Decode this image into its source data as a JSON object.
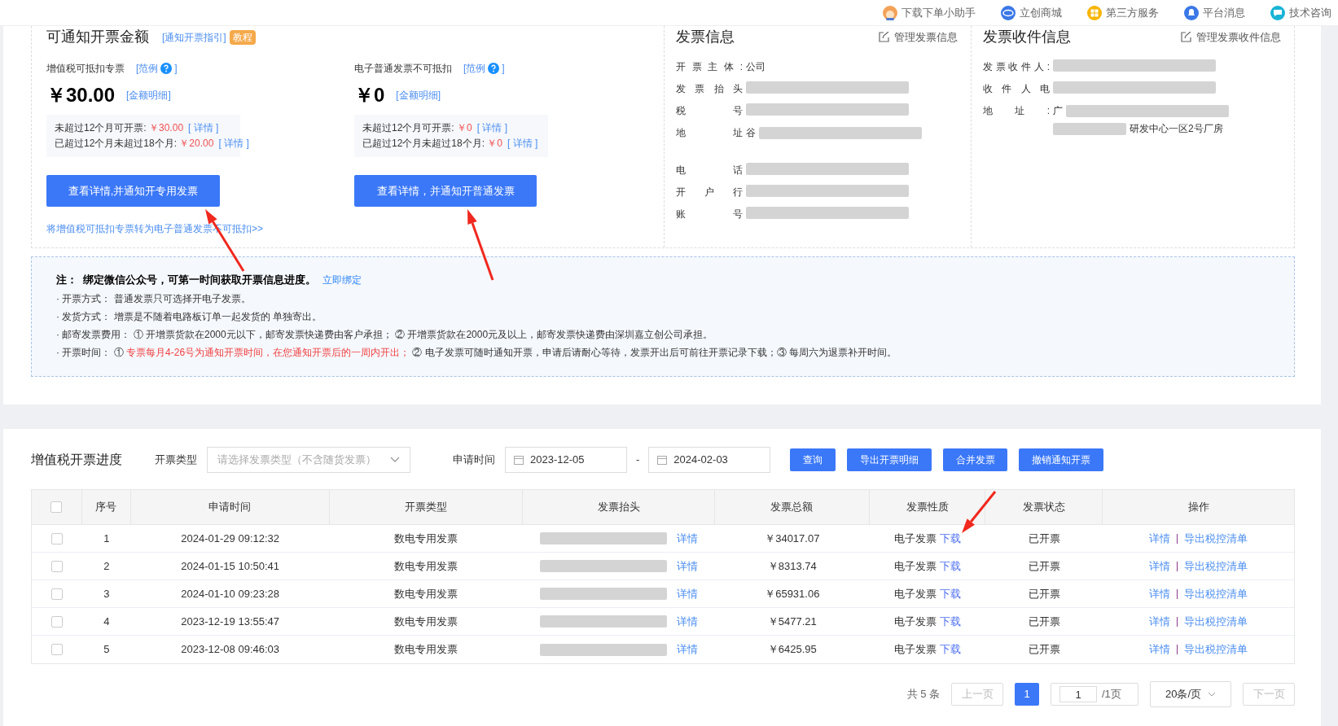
{
  "top_nav": [
    {
      "label": "下载下单小助手"
    },
    {
      "label": "立创商城"
    },
    {
      "label": "第三方服务"
    },
    {
      "label": "平台消息"
    },
    {
      "label": "技术咨询"
    }
  ],
  "amount_section": {
    "title": "可通知开票金额",
    "guide_link": "[通知开票指引]",
    "badge": "教程",
    "cards": [
      {
        "label": "增值税可抵扣专票",
        "example_open": "[范例",
        "example_close": "]",
        "amount": "￥30.00",
        "detail_link": "[金额明细]",
        "lines": [
          {
            "label": "未超过12个月可开票:",
            "value": "￥30.00",
            "link": "[ 详情 ]"
          },
          {
            "label": "已超过12个月未超过18个月:",
            "value": "￥20.00",
            "link": "[ 详情 ]"
          }
        ],
        "button": "查看详情,并通知开专用发票",
        "convert_link": "将增值税可抵扣专票转为电子普通发票不可抵扣>>"
      },
      {
        "label": "电子普通发票不可抵扣",
        "example_open": "[范例",
        "example_close": "]",
        "amount": "￥0",
        "detail_link": "[金额明细]",
        "lines": [
          {
            "label": "未超过12个月可开票:",
            "value": "￥0",
            "link": "[ 详情 ]"
          },
          {
            "label": "已超过12个月未超过18个月:",
            "value": "￥0",
            "link": "[ 详情 ]"
          }
        ],
        "button": "查看详情，并通知开普通发票"
      }
    ]
  },
  "invoice_info": {
    "title": "发票信息",
    "manage_link": "管理发票信息",
    "fields": [
      {
        "label": "开票主体:",
        "value": "公司",
        "blurred": false
      },
      {
        "label": "发票抬头",
        "blurred": true
      },
      {
        "label": "税号",
        "blurred": true
      },
      {
        "label": "地址",
        "value": "谷",
        "blurred": true
      },
      {
        "label": "电话",
        "blurred": true
      },
      {
        "label": "开户行",
        "blurred": true
      },
      {
        "label": "账号",
        "blurred": true
      }
    ]
  },
  "shipping_info": {
    "title": "发票收件信息",
    "manage_link": "管理发票收件信息",
    "fields": [
      {
        "label": "发票收件人:",
        "blurred": true
      },
      {
        "label": "收件人电",
        "blurred": true
      },
      {
        "label": "地址:",
        "value": "广",
        "extra": "研发中心一区2号厂房",
        "blurred": true
      }
    ]
  },
  "notice": {
    "title": "注：  绑定微信公众号，可第一时间获取开票信息进度。",
    "bind_link": "立即绑定",
    "items": [
      {
        "label": "· 开票方式：",
        "parts": [
          {
            "text": "普通发票只可选择开电子发票。",
            "highlight": false
          }
        ]
      },
      {
        "label": "· 发货方式：",
        "parts": [
          {
            "text": "增票是不随着电路板订单一起发货的 单独寄出。",
            "highlight": false
          }
        ]
      },
      {
        "label": "· 邮寄发票费用：",
        "parts": [
          {
            "text": "① 开增票货款在2000元以下，邮寄发票快递费由客户承担； ② 开增票货款在2000元及以上，邮寄发票快递费由深圳嘉立创公司承担。",
            "highlight": false
          }
        ]
      },
      {
        "label": "· 开票时间：",
        "parts": [
          {
            "text": "① ",
            "highlight": false
          },
          {
            "text": "专票每月4-26号为通知开票时间，在您通知开票后的一周内开出；",
            "highlight": true
          },
          {
            "text": " ② 电子发票可随时通知开票，申请后请耐心等待，发票开出后可前往开票记录下载；③ 每周六为退票补开时间。",
            "highlight": false
          }
        ]
      }
    ]
  },
  "progress": {
    "title": "增值税开票进度",
    "type_label": "开票类型",
    "type_placeholder": "请选择发票类型（不含随货发票）",
    "time_label": "申请时间",
    "date_from": "2023-12-05",
    "date_sep": "-",
    "date_to": "2024-02-03",
    "buttons": [
      "查询",
      "导出开票明细",
      "合并发票",
      "撤销通知开票"
    ],
    "table": {
      "header_checked": false,
      "columns": [
        "序号",
        "申请时间",
        "开票类型",
        "发票抬头",
        "发票总额",
        "发票性质",
        "发票状态",
        "操作"
      ],
      "rows": [
        {
          "checked": false,
          "index": "1",
          "time": "2024-01-29 09:12:32",
          "type": "数电专用发票",
          "title_link": "详情",
          "total": "￥34017.07",
          "nature": "电子发票",
          "download": "下载",
          "status": "已开票",
          "actions": [
            "详情",
            "导出税控清单"
          ]
        },
        {
          "checked": false,
          "index": "2",
          "time": "2024-01-15 10:50:41",
          "type": "数电专用发票",
          "title_link": "详情",
          "total": "￥8313.74",
          "nature": "电子发票",
          "download": "下载",
          "status": "已开票",
          "actions": [
            "详情",
            "导出税控清单"
          ]
        },
        {
          "checked": false,
          "index": "3",
          "time": "2024-01-10 09:23:28",
          "type": "数电专用发票",
          "title_link": "详情",
          "total": "￥65931.06",
          "nature": "电子发票",
          "download": "下载",
          "status": "已开票",
          "actions": [
            "详情",
            "导出税控清单"
          ]
        },
        {
          "checked": false,
          "index": "4",
          "time": "2023-12-19 13:55:47",
          "type": "数电专用发票",
          "title_link": "详情",
          "total": "￥5477.21",
          "nature": "电子发票",
          "download": "下载",
          "status": "已开票",
          "actions": [
            "详情",
            "导出税控清单"
          ]
        },
        {
          "checked": false,
          "index": "5",
          "time": "2023-12-08 09:46:03",
          "type": "数电专用发票",
          "title_link": "详情",
          "total": "￥6425.95",
          "nature": "电子发票",
          "download": "下载",
          "status": "已开票",
          "actions": [
            "详情",
            "导出税控清单"
          ]
        }
      ]
    },
    "pagination": {
      "total": "共 5 条",
      "prev": "上一页",
      "pages": [
        {
          "label": "1",
          "selected": true
        }
      ],
      "page_input": "1",
      "page_count": "/1页",
      "page_size": "20条/页",
      "next": "下一页"
    }
  },
  "annotations": [
    {
      "kind": "arrow"
    },
    {
      "kind": "arrow"
    },
    {
      "kind": "arrow"
    }
  ]
}
